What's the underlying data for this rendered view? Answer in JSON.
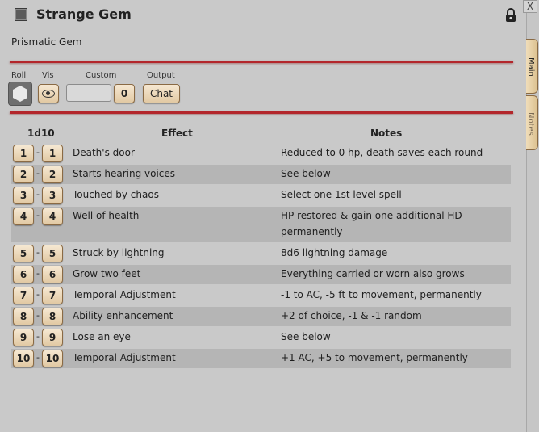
{
  "window": {
    "title": "Strange Gem",
    "subtitle": "Prismatic Gem",
    "close_label": "X"
  },
  "controls": {
    "roll_label": "Roll",
    "vis_label": "Vis",
    "custom_label": "Custom",
    "output_label": "Output",
    "custom_value": "",
    "custom_count": "0",
    "chat_label": "Chat"
  },
  "table": {
    "headers": {
      "dice": "1d10",
      "effect": "Effect",
      "notes": "Notes"
    },
    "rows": [
      {
        "from": "1",
        "to": "1",
        "effect": "Death's door",
        "notes": "Reduced to 0 hp, death saves each round"
      },
      {
        "from": "2",
        "to": "2",
        "effect": "Starts hearing voices",
        "notes": "See below"
      },
      {
        "from": "3",
        "to": "3",
        "effect": "Touched by chaos",
        "notes": "Select one 1st level spell"
      },
      {
        "from": "4",
        "to": "4",
        "effect": "Well of health",
        "notes": "HP restored  & gain one additional HD permanently"
      },
      {
        "from": "5",
        "to": "5",
        "effect": "Struck by lightning",
        "notes": "8d6 lightning damage"
      },
      {
        "from": "6",
        "to": "6",
        "effect": "Grow two feet",
        "notes": "Everything carried or worn also grows"
      },
      {
        "from": "7",
        "to": "7",
        "effect": "Temporal Adjustment",
        "notes": "-1 to AC, -5 ft to movement, permanently"
      },
      {
        "from": "8",
        "to": "8",
        "effect": "Ability enhancement",
        "notes": "+2 of choice, -1 & -1 random"
      },
      {
        "from": "9",
        "to": "9",
        "effect": "Lose an eye",
        "notes": "See below"
      },
      {
        "from": "10",
        "to": "10",
        "effect": "Temporal Adjustment",
        "notes": "+1 AC, +5 to movement, permanently"
      }
    ]
  },
  "tabs": {
    "main": "Main",
    "notes": "Notes"
  },
  "colors": {
    "accent_red": "#b3262b",
    "button_tan": "#e8d3b0",
    "background": "#c9c9c9"
  },
  "icons": [
    "lock-icon",
    "eye-icon",
    "dice-hexagon-icon"
  ]
}
